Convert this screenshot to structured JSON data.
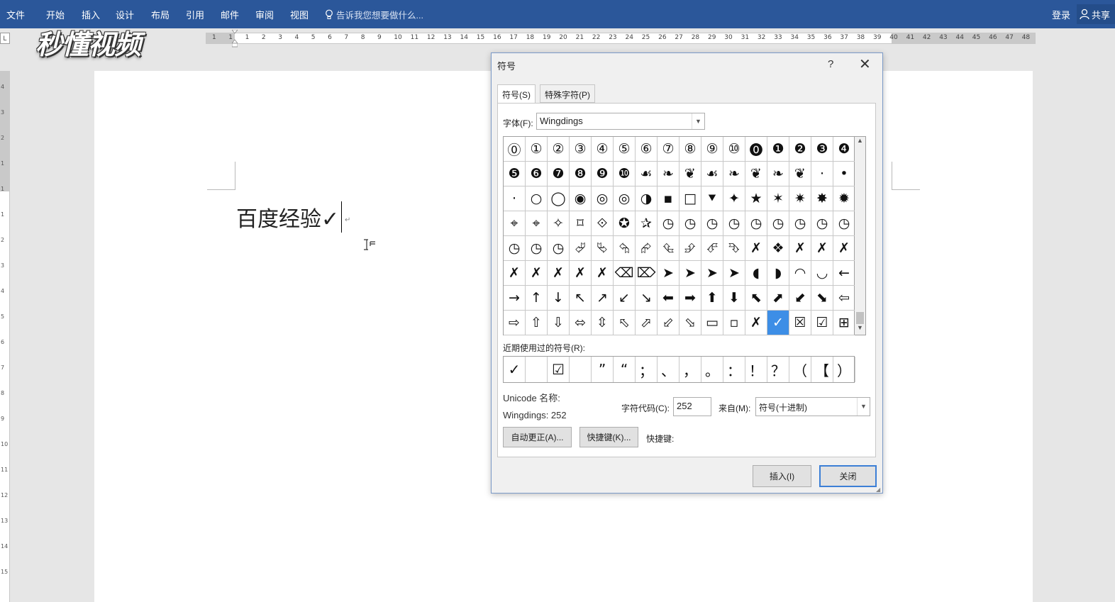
{
  "menu": {
    "items": [
      "文件",
      "开始",
      "插入",
      "设计",
      "布局",
      "引用",
      "邮件",
      "审阅",
      "视图"
    ],
    "tell_me": "告诉我您想要做什么...",
    "login": "登录",
    "share": "共享"
  },
  "ruler": {
    "corner": "L",
    "numbers": [
      "1",
      "1",
      "1",
      "2",
      "3",
      "4",
      "5",
      "6",
      "7",
      "8",
      "9",
      "10",
      "11",
      "12",
      "13",
      "14",
      "15",
      "16",
      "17",
      "18",
      "19",
      "20",
      "21",
      "22",
      "23",
      "24",
      "25",
      "26",
      "27",
      "28",
      "29",
      "30",
      "31",
      "32",
      "33",
      "34",
      "35",
      "36",
      "37",
      "38",
      "39",
      "40",
      "41",
      "42",
      "43",
      "44",
      "45",
      "46",
      "47",
      "48"
    ],
    "vertical_numbers": [
      "4",
      "3",
      "2",
      "1",
      "1",
      "1",
      "2",
      "3",
      "4",
      "5",
      "6",
      "7",
      "8",
      "9",
      "10",
      "11",
      "12",
      "13",
      "14",
      "15"
    ]
  },
  "watermark": "秒懂视频",
  "document": {
    "text": "百度经验✓",
    "paragraph_mark": "↵"
  },
  "dialog": {
    "title": "符号",
    "help": "?",
    "close": "✕",
    "tabs": [
      "符号(S)",
      "特殊字符(P)"
    ],
    "font_label": "字体(F):",
    "font_value": "Wingdings",
    "grid_rows": [
      [
        "⓪",
        "①",
        "②",
        "③",
        "④",
        "⑤",
        "⑥",
        "⑦",
        "⑧",
        "⑨",
        "⑩",
        "⓿",
        "❶",
        "❷",
        "❸",
        "❹"
      ],
      [
        "❺",
        "❻",
        "❼",
        "❽",
        "❾",
        "❿",
        "☙",
        "❧",
        "❦",
        "☙",
        "❧",
        "❦",
        "❧",
        "❦",
        "·",
        "•"
      ],
      [
        "·",
        "○",
        "◯",
        "◉",
        "◎",
        "◎",
        "◑",
        "▪",
        "□",
        "⯆",
        "✦",
        "★",
        "✶",
        "✷",
        "✸",
        "✹"
      ],
      [
        "⌖",
        "⌖",
        "✧",
        "⌑",
        "⟐",
        "✪",
        "✰",
        "◷",
        "◷",
        "◷",
        "◷",
        "◷",
        "◷",
        "◷",
        "◷",
        "◷"
      ],
      [
        "◷",
        "◷",
        "◷",
        "⮰",
        "⮱",
        "⮲",
        "⮳",
        "⮴",
        "⮵",
        "⮶",
        "⮷",
        "✗",
        "❖",
        "✗",
        "✗",
        "✗"
      ],
      [
        "✗",
        "✗",
        "✗",
        "✗",
        "✗",
        "⌫",
        "⌦",
        "➤",
        "➤",
        "➤",
        "➤",
        "◖",
        "◗",
        "◠",
        "◡",
        "←"
      ],
      [
        "→",
        "↑",
        "↓",
        "↖",
        "↗",
        "↙",
        "↘",
        "⬅",
        "➡",
        "⬆",
        "⬇",
        "⬉",
        "⬈",
        "⬋",
        "⬊",
        "⇦"
      ],
      [
        "⇨",
        "⇧",
        "⇩",
        "⬄",
        "⇳",
        "⬁",
        "⬀",
        "⬃",
        "⬂",
        "▭",
        "▫",
        "✗",
        "✓",
        "☒",
        "☑",
        "⊞"
      ]
    ],
    "selected_cell": "✓",
    "recent_label": "近期使用过的符号(R):",
    "recent": [
      "✓",
      "",
      "☑",
      "",
      "”",
      "“",
      "；",
      "、",
      "，",
      "。",
      "：",
      "！",
      "？",
      "（",
      "【",
      "）"
    ],
    "unicode_name_label": "Unicode 名称:",
    "unicode_value": "Wingdings: 252",
    "char_code_label": "字符代码(C):",
    "char_code_value": "252",
    "from_label": "来自(M):",
    "from_value": "符号(十进制)",
    "autocorrect_button": "自动更正(A)...",
    "shortcut_button": "快捷键(K)...",
    "shortcut_label": "快捷键:",
    "insert_button": "插入(I)",
    "close_button": "关闭"
  },
  "colors": {
    "ribbon": "#2b579a",
    "selection": "#3d8ee6",
    "primary_border": "#3c7fd6"
  }
}
